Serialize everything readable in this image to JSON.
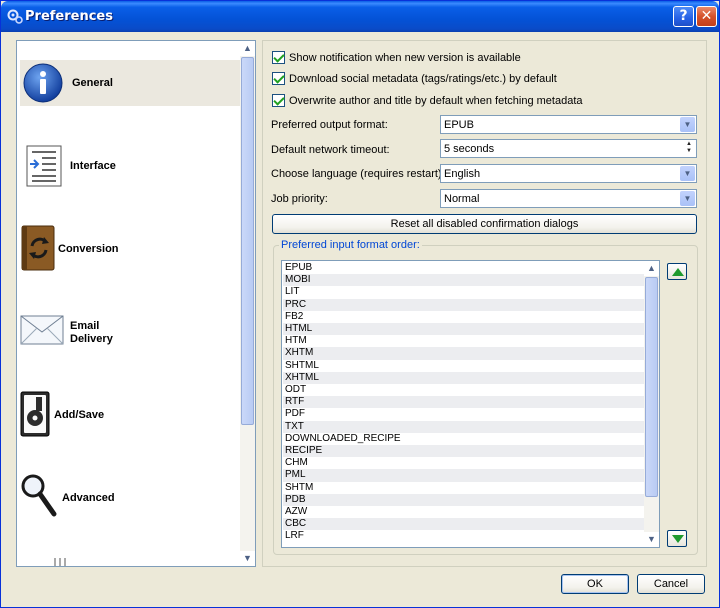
{
  "window": {
    "title": "Preferences",
    "help_label": "?",
    "close_label": "✕"
  },
  "nav": {
    "items": [
      {
        "label": "General",
        "icon": "info-icon",
        "selected": true
      },
      {
        "label": "Interface",
        "icon": "document-indent-icon"
      },
      {
        "label": "Conversion",
        "icon": "conversion-book-icon"
      },
      {
        "label_line1": "Email",
        "label_line2": "Delivery",
        "icon": "envelope-icon"
      },
      {
        "label": "Add/Save",
        "icon": "disk-icon"
      },
      {
        "label": "Advanced",
        "icon": "magnifier-icon"
      }
    ]
  },
  "general": {
    "checkboxes": [
      {
        "label": "Show notification when new version is available",
        "checked": true
      },
      {
        "label": "Download social metadata (tags/ratings/etc.) by default",
        "checked": true
      },
      {
        "label": "Overwrite author and title by default when fetching metadata",
        "checked": true
      }
    ],
    "output_format": {
      "label": "Preferred output format:",
      "value": "EPUB"
    },
    "network_timeout": {
      "label": "Default network timeout:",
      "value": "5 seconds"
    },
    "language": {
      "label": "Choose language (requires restart):",
      "value": "English"
    },
    "job_priority": {
      "label": "Job priority:",
      "value": "Normal"
    },
    "reset_button": "Reset all disabled confirmation dialogs",
    "input_order": {
      "title": "Preferred input format order:",
      "formats": [
        "EPUB",
        "MOBI",
        "LIT",
        "PRC",
        "FB2",
        "HTML",
        "HTM",
        "XHTM",
        "SHTML",
        "XHTML",
        "ODT",
        "RTF",
        "PDF",
        "TXT",
        "DOWNLOADED_RECIPE",
        "RECIPE",
        "CHM",
        "PML",
        "SHTM",
        "PDB",
        "AZW",
        "CBC",
        "LRF"
      ]
    }
  },
  "footer": {
    "ok_label": "OK",
    "cancel_label": "Cancel"
  },
  "colors": {
    "titlebar": "#0452d6",
    "panel": "#ece9d8",
    "group_title": "#0046d5",
    "arrow_green": "#1f9a2e"
  }
}
